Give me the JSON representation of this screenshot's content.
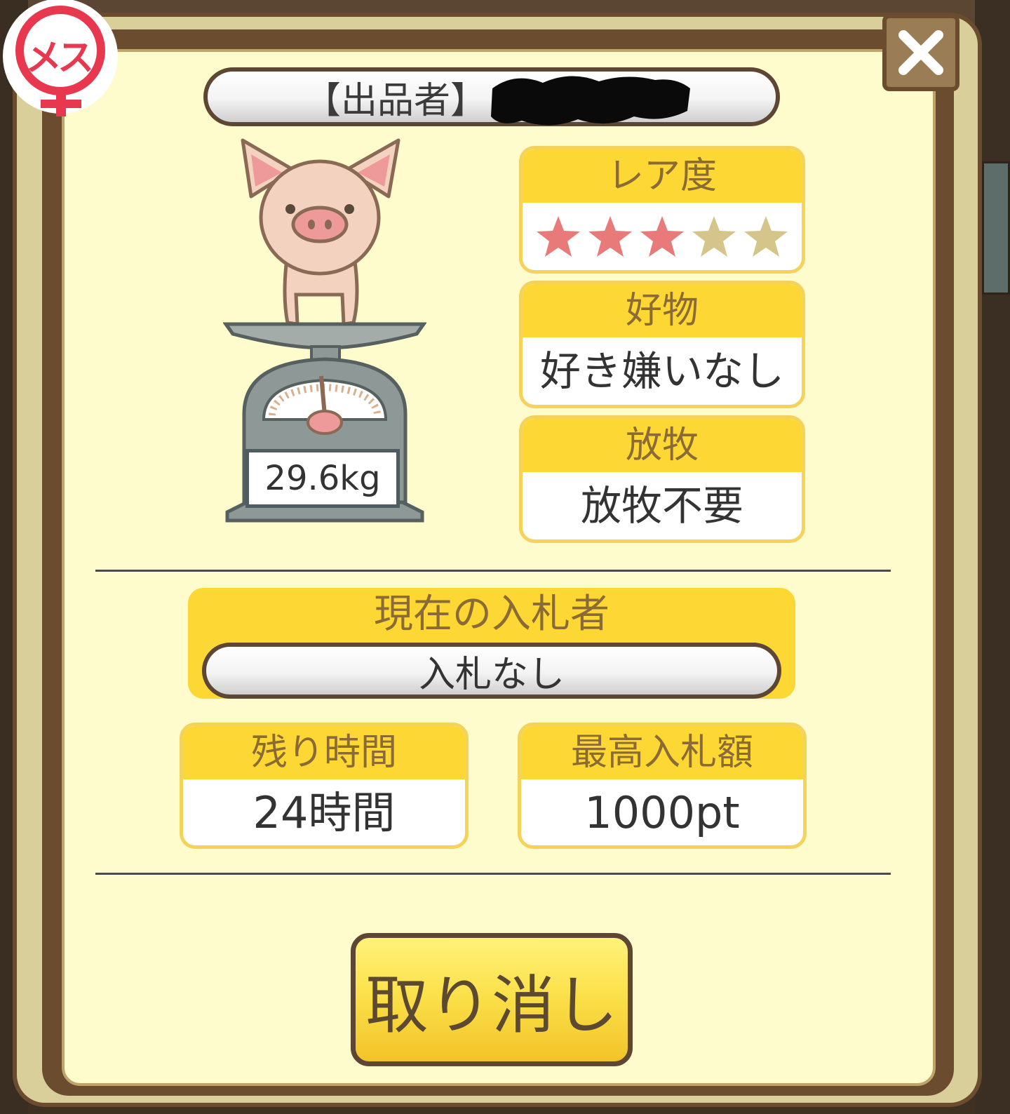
{
  "badge": {
    "text": "メス",
    "icon": "female-icon",
    "color": "#e8384f"
  },
  "seller": {
    "label": "【出品者】"
  },
  "pig": {
    "weight": "29.6kg"
  },
  "rarity": {
    "title": "レア度",
    "rating": 3,
    "max": 5,
    "filled_color": "#e87a7a",
    "empty_color": "#d6c58a"
  },
  "favorite": {
    "title": "好物",
    "value": "好き嫌いなし"
  },
  "grazing": {
    "title": "放牧",
    "value": "放牧不要"
  },
  "bidder": {
    "title": "現在の入札者",
    "value": "入札なし"
  },
  "remaining_time": {
    "title": "残り時間",
    "value": "24時間"
  },
  "max_bid": {
    "title": "最高入札額",
    "value": "1000pt"
  },
  "cancel_button": {
    "label": "取り消し"
  },
  "close_button": {
    "icon": "close-icon"
  }
}
